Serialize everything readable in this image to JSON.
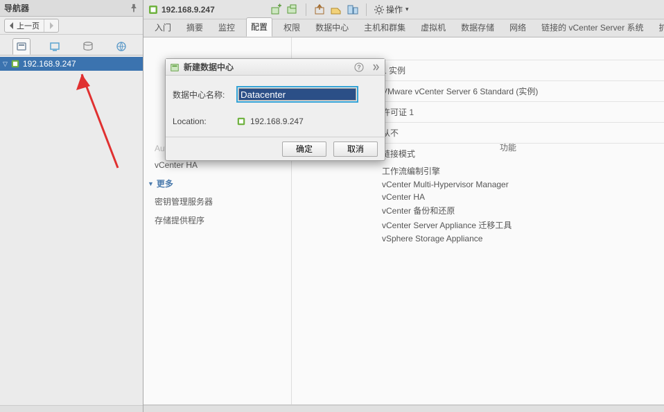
{
  "navigator": {
    "title": "导航器",
    "back_label": "上一页",
    "tree_item": "192.168.9.247"
  },
  "main": {
    "address": "192.168.9.247",
    "actions_label": "操作",
    "tabs": [
      "入门",
      "摘要",
      "监控",
      "配置",
      "权限",
      "数据中心",
      "主机和群集",
      "虚拟机",
      "数据存储",
      "网络",
      "链接的 vCenter Server 系统",
      "扩展"
    ],
    "active_tab_index": 3
  },
  "config_side": {
    "items": [
      "Auto Deploy",
      "vCenter HA"
    ],
    "group_more": "更多",
    "more_items": [
      "密钥管理服务器",
      "存储提供程序"
    ]
  },
  "info": {
    "fragment_gongneng": "功能",
    "rows_top": [
      "1 实例",
      "VMware vCenter Server 6 Standard (实例)",
      "许可证 1",
      "从不",
      "链接模式"
    ],
    "rows_list": [
      "工作流编制引擎",
      "vCenter Multi-Hypervisor Manager",
      "vCenter HA",
      "vCenter 备份和还原",
      "vCenter Server Appliance 迁移工具",
      "vSphere Storage Appliance"
    ]
  },
  "modal": {
    "title": "新建数据中心",
    "label_name": "数据中心名称:",
    "input_value": "Datacenter",
    "label_location": "Location:",
    "location_value": "192.168.9.247",
    "ok": "确定",
    "cancel": "取消"
  }
}
